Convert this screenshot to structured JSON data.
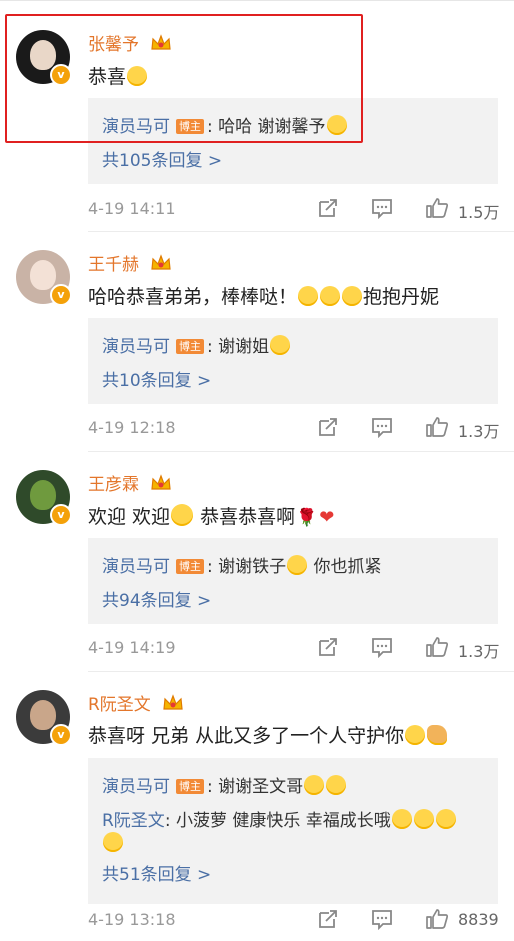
{
  "comments": [
    {
      "username": "张馨予",
      "text": "恭喜",
      "replies": [
        {
          "name": "演员马可",
          "tag": "博主",
          "text": ": 哈哈 谢谢馨予"
        }
      ],
      "more_replies": "共105条回复 >",
      "time": "4-19 14:11",
      "likes": "1.5万"
    },
    {
      "username": "王千赫",
      "text": "哈哈恭喜弟弟，棒棒哒！",
      "text_after": "抱抱丹妮",
      "replies": [
        {
          "name": "演员马可",
          "tag": "博主",
          "text": ": 谢谢姐"
        }
      ],
      "more_replies": "共10条回复 >",
      "time": "4-19 12:18",
      "likes": "1.3万"
    },
    {
      "username": "王彦霖",
      "text": "欢迎 欢迎",
      "text_after": " 恭喜恭喜啊",
      "replies": [
        {
          "name": "演员马可",
          "tag": "博主",
          "text": ": 谢谢铁子",
          "text_after": " 你也抓紧"
        }
      ],
      "more_replies": "共94条回复 >",
      "time": "4-19 14:19",
      "likes": "1.3万"
    },
    {
      "username": "R阮圣文",
      "text": "恭喜呀 兄弟 从此又多了一个人守护你",
      "replies": [
        {
          "name": "演员马可",
          "tag": "博主",
          "text": ": 谢谢圣文哥"
        },
        {
          "name": "R阮圣文",
          "text": ": 小菠萝 健康快乐 幸福成长哦"
        }
      ],
      "more_replies": "共51条回复 >",
      "time": "4-19 13:18",
      "likes": "8839"
    }
  ],
  "colors": {
    "username": "#e3762b",
    "link": "#4a6fa5",
    "highlight": "#e02020",
    "tag": "#f28a36"
  },
  "icons": [
    "forward-icon",
    "comment-icon",
    "like-icon",
    "verified-badge-icon",
    "crown-badge-icon"
  ]
}
